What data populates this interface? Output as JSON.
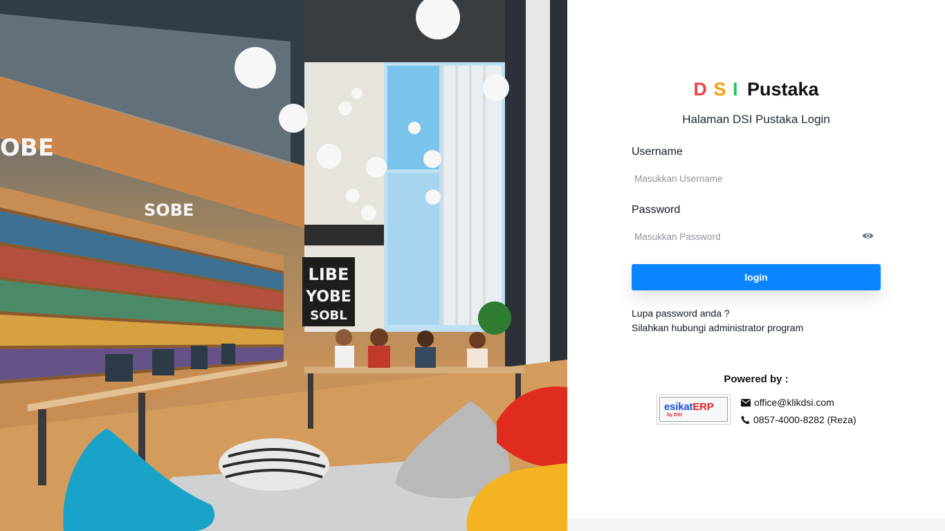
{
  "brand": {
    "letter1": "D",
    "letter2": "S",
    "letter3": "I",
    "name": "Pustaka"
  },
  "subtitle": "Halaman DSI Pustaka Login",
  "username": {
    "label": "Username",
    "placeholder": "Masukkan Username",
    "value": ""
  },
  "password": {
    "label": "Password",
    "placeholder": "Masukkan Password",
    "value": "",
    "toggle_icon": "eye-icon"
  },
  "login_button": "login",
  "help": {
    "line1": "Lupa password anda ?",
    "line2": "Silahkan hubungi administrator program"
  },
  "powered_by": "Powered by :",
  "partner_logo": {
    "text_primary": "esikat",
    "text_accent": "ERP",
    "sub": "by DSI"
  },
  "contact": {
    "email": "office@klikdsi.com",
    "phone": "0857-4000-8282 (Reza)",
    "email_icon": "envelope-icon",
    "phone_icon": "phone-icon"
  },
  "hero_signs": {
    "sign_line1": "LIBE",
    "sign_line2": "YOBE",
    "sign_line3": "SOBL",
    "wall_text_1": "OBE",
    "wall_text_2": "SOBE"
  },
  "colors": {
    "brand_d": "#ef4444",
    "brand_s": "#f59e0b",
    "brand_i": "#22c55e",
    "login_button": "#0a84ff"
  }
}
